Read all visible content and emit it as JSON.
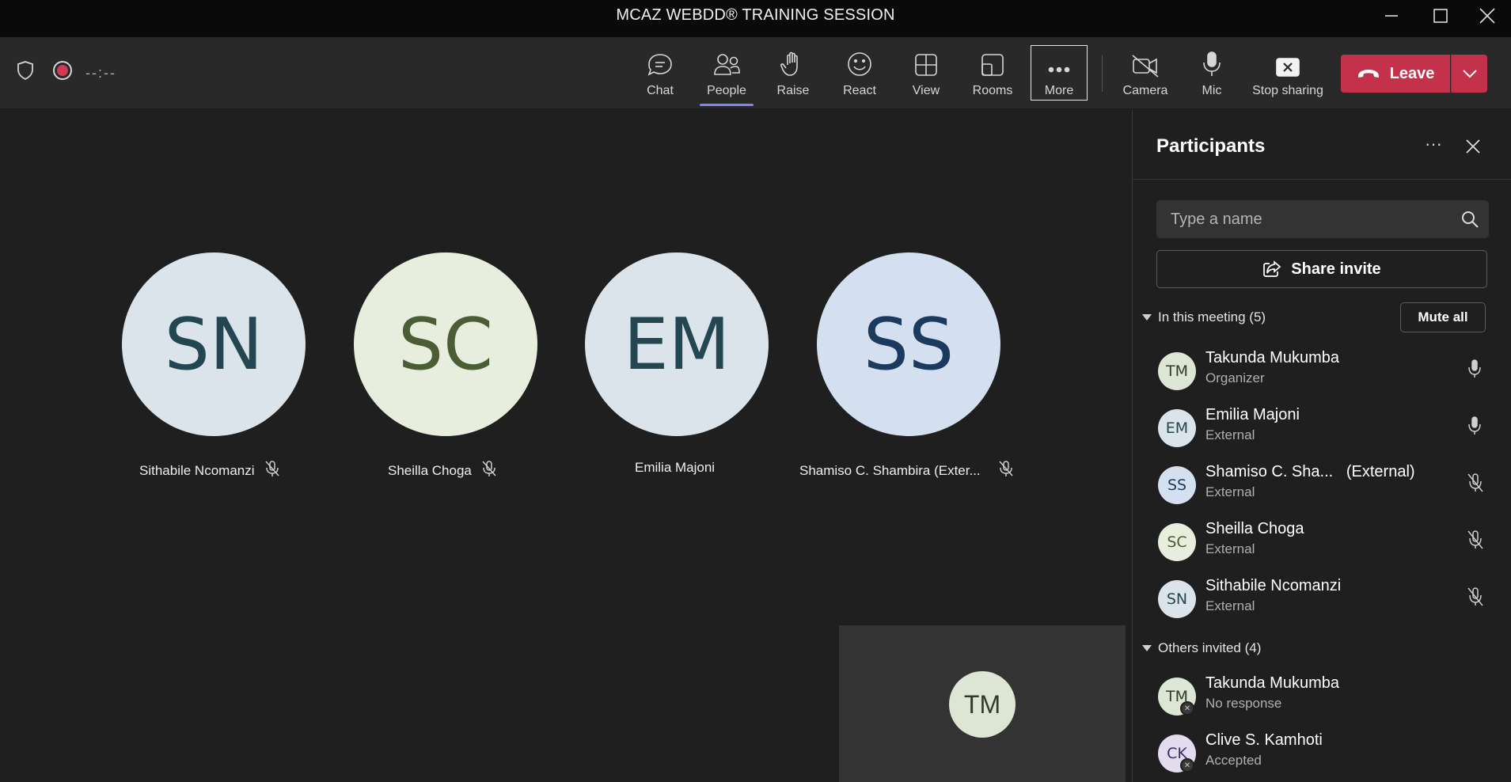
{
  "window": {
    "title": "MCAZ WEBDD® TRAINING SESSION"
  },
  "toolbar": {
    "timer": "--:--",
    "buttons": [
      {
        "label": "Chat",
        "icon": "chat-icon"
      },
      {
        "label": "People",
        "icon": "people-icon",
        "active": true
      },
      {
        "label": "Raise",
        "icon": "raise-hand-icon"
      },
      {
        "label": "React",
        "icon": "react-icon"
      },
      {
        "label": "View",
        "icon": "view-grid-icon"
      },
      {
        "label": "Rooms",
        "icon": "rooms-icon"
      },
      {
        "label": "More",
        "icon": "more-icon"
      },
      {
        "label": "Camera",
        "icon": "camera-off-icon"
      },
      {
        "label": "Mic",
        "icon": "mic-icon"
      },
      {
        "label": "Stop sharing",
        "icon": "stop-sharing-icon"
      }
    ],
    "leave_label": "Leave",
    "accent_color": "#7f85f5",
    "leave_color": "#c4314b"
  },
  "stage": {
    "tiles": [
      {
        "initials": "SN",
        "name": "Sithabile Ncomanzi",
        "muted": true,
        "bg": "#dbe4ea",
        "fg": "#234650"
      },
      {
        "initials": "SC",
        "name": "Sheilla Choga",
        "muted": true,
        "bg": "#e8eedd",
        "fg": "#4a5d35"
      },
      {
        "initials": "EM",
        "name": "Emilia Majoni",
        "muted": false,
        "bg": "#dbe4ea",
        "fg": "#234650"
      },
      {
        "initials": "SS",
        "name": "Shamiso C. Shambira (Exter...",
        "muted": true,
        "bg": "#d4dff0",
        "fg": "#1b3a5e"
      }
    ],
    "self_view": {
      "initials": "TM"
    }
  },
  "panel": {
    "title": "Participants",
    "more": "···",
    "search_placeholder": "Type a name",
    "share_invite": "Share invite",
    "in_meeting_label": "In this meeting (5)",
    "mute_all": "Mute all",
    "in_meeting": [
      {
        "initials": "TM",
        "name": "Takunda Mukumba",
        "role": "Organizer",
        "mic": "on",
        "bg": "#dde5d4",
        "fg": "#2f3d26"
      },
      {
        "initials": "EM",
        "name": "Emilia Majoni",
        "role": "External",
        "mic": "on",
        "bg": "#dbe4ea",
        "fg": "#234650"
      },
      {
        "initials": "SS",
        "name": "Shamiso C. Sha...   (External)",
        "role": "External",
        "mic": "off",
        "bg": "#d4dff0",
        "fg": "#1b3a5e"
      },
      {
        "initials": "SC",
        "name": "Sheilla Choga",
        "role": "External",
        "mic": "off",
        "bg": "#e8eedd",
        "fg": "#4a5d35"
      },
      {
        "initials": "SN",
        "name": "Sithabile Ncomanzi",
        "role": "External",
        "mic": "off",
        "bg": "#dbe4ea",
        "fg": "#234650"
      }
    ],
    "others_label": "Others invited (4)",
    "others": [
      {
        "initials": "TM",
        "name": "Takunda Mukumba",
        "role": "No response",
        "bg": "#dde5d4",
        "fg": "#2f3d26"
      },
      {
        "initials": "CK",
        "name": "Clive S. Kamhoti",
        "role": "Accepted",
        "bg": "#e3dcef",
        "fg": "#3d2d66"
      }
    ]
  }
}
